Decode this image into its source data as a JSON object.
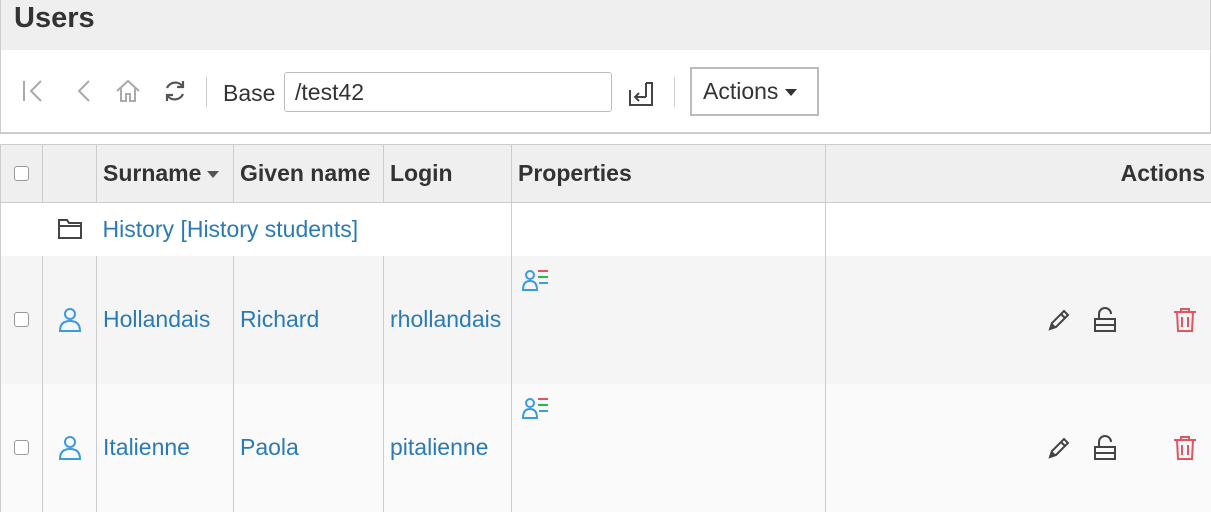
{
  "page": {
    "title": "Users"
  },
  "toolbar": {
    "base_label": "Base",
    "base_value": "/test42",
    "actions_label": "Actions",
    "icons": [
      "first-page-icon",
      "back-icon",
      "home-icon",
      "refresh-icon",
      "submit-icon"
    ]
  },
  "table": {
    "columns": {
      "surname": "Surname",
      "given_name": "Given name",
      "login": "Login",
      "properties": "Properties",
      "actions": "Actions"
    },
    "group_row": {
      "label": "History [History students]",
      "icon": "folder-icon"
    },
    "rows": [
      {
        "surname": "Hollandais",
        "given_name": "Richard",
        "login": "rhollandais"
      },
      {
        "surname": "Italienne",
        "given_name": "Paola",
        "login": "pitalienne"
      }
    ],
    "row_icons": [
      "user-icon",
      "properties-icon",
      "edit-icon",
      "lock-icon",
      "delete-icon"
    ]
  },
  "colors": {
    "link": "#2a7ab5",
    "icon_blue": "#3a9be0",
    "delete_red": "#e05560",
    "header_bg": "#efefef"
  }
}
